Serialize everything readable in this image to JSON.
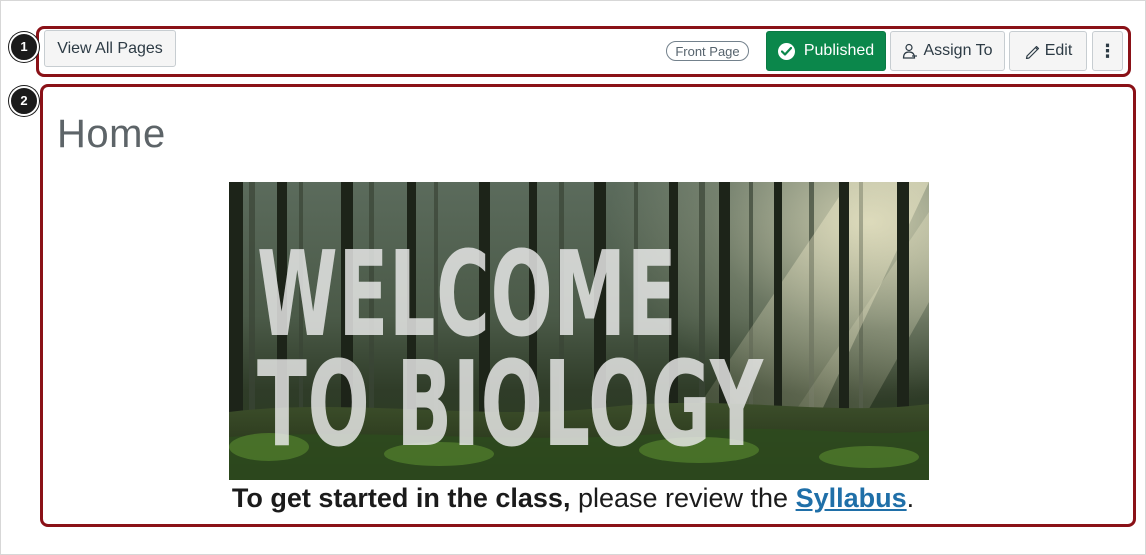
{
  "toolbar": {
    "view_all_label": "View All Pages",
    "front_page_badge": "Front Page",
    "published_label": "Published",
    "assign_label": "Assign To",
    "edit_label": "Edit",
    "more_label": "⋮"
  },
  "callouts": [
    "1",
    "2"
  ],
  "page": {
    "title": "Home",
    "banner_line1": "WELCOME",
    "banner_line2": "TO BIOLOGY",
    "intro_bold": "To get started in the class,",
    "intro_text": " please review the ",
    "syllabus_link": "Syllabus",
    "intro_end": "."
  },
  "colors": {
    "published_green": "#0b874b",
    "highlight_red": "#8a1117",
    "link_blue": "#1f6fa8"
  }
}
